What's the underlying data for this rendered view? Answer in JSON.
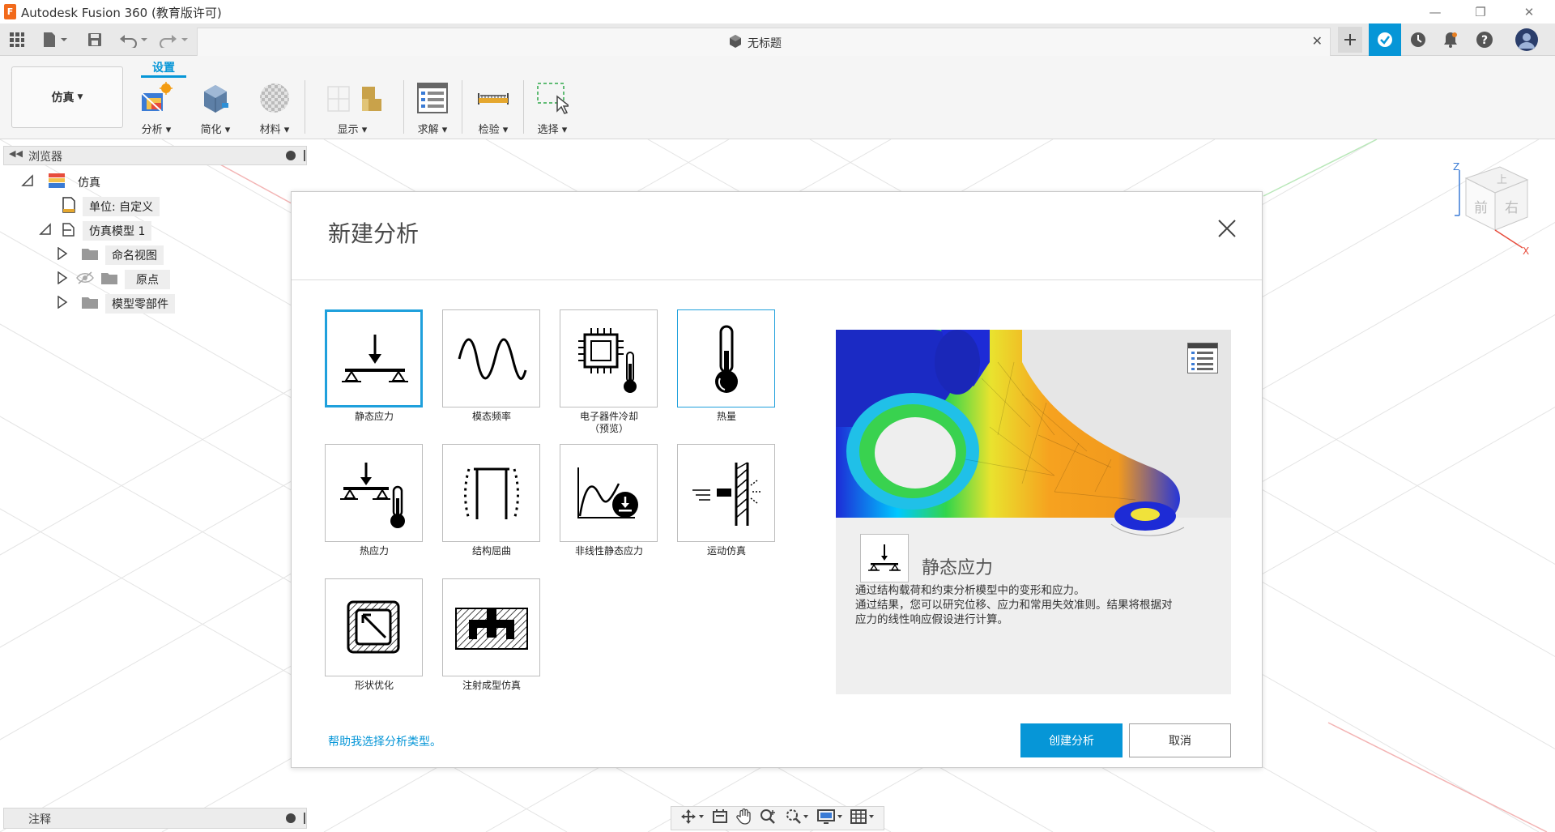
{
  "window": {
    "title": "Autodesk Fusion 360 (教育版许可)",
    "logo_letter": "F",
    "controls": {
      "minimize": "—",
      "maximize": "❐",
      "close": "✕"
    }
  },
  "document_tab": {
    "title": "无标题",
    "close": "✕"
  },
  "toolbar": {
    "workspace": "仿真",
    "active_tab": "设置",
    "tools": [
      {
        "label": "分析 ▾",
        "icon": "analysis-icon"
      },
      {
        "label": "简化 ▾",
        "icon": "simplify-icon"
      },
      {
        "label": "材料 ▾",
        "icon": "material-icon"
      },
      {
        "label": "显示 ▾",
        "icon": "display-icon"
      },
      {
        "label": "求解 ▾",
        "icon": "solve-icon"
      },
      {
        "label": "检验 ▾",
        "icon": "inspect-icon"
      },
      {
        "label": "选择 ▾",
        "icon": "select-icon"
      }
    ]
  },
  "browser": {
    "title": "浏览器",
    "items": [
      {
        "label": "仿真"
      },
      {
        "label": "单位: 自定义"
      },
      {
        "label": "仿真模型 1"
      },
      {
        "label": "命名视图"
      },
      {
        "label": "原点"
      },
      {
        "label": "模型零部件"
      }
    ]
  },
  "dialog": {
    "title": "新建分析",
    "tiles": [
      {
        "label": "静态应力",
        "icon": "static-stress-icon"
      },
      {
        "label": "模态频率",
        "icon": "modal-frequency-icon"
      },
      {
        "label": "电子器件冷却",
        "sublabel": "（预览）",
        "icon": "electronics-cooling-icon"
      },
      {
        "label": "热量",
        "icon": "thermal-icon"
      },
      {
        "label": "热应力",
        "icon": "thermal-stress-icon"
      },
      {
        "label": "结构屈曲",
        "icon": "structural-buckling-icon"
      },
      {
        "label": "非线性静态应力",
        "icon": "nonlinear-static-stress-icon"
      },
      {
        "label": "运动仿真",
        "icon": "event-simulation-icon"
      },
      {
        "label": "形状优化",
        "icon": "shape-optimization-icon"
      },
      {
        "label": "注射成型仿真",
        "icon": "injection-molding-icon"
      }
    ],
    "preview": {
      "name": "静态应力",
      "description": [
        "通过结构载荷和约束分析模型中的变形和应力。",
        "通过结果，您可以研究位移、应力和常用失效准则。结果将根据对",
        "应力的线性响应假设进行计算。"
      ]
    },
    "help_link": "帮助我选择分析类型。",
    "create_button": "创建分析",
    "cancel_button": "取消"
  },
  "viewcube": {
    "top": "上",
    "front": "前",
    "right": "右",
    "axis_z": "Z",
    "axis_x": "X"
  },
  "notes": {
    "title": "注释"
  }
}
